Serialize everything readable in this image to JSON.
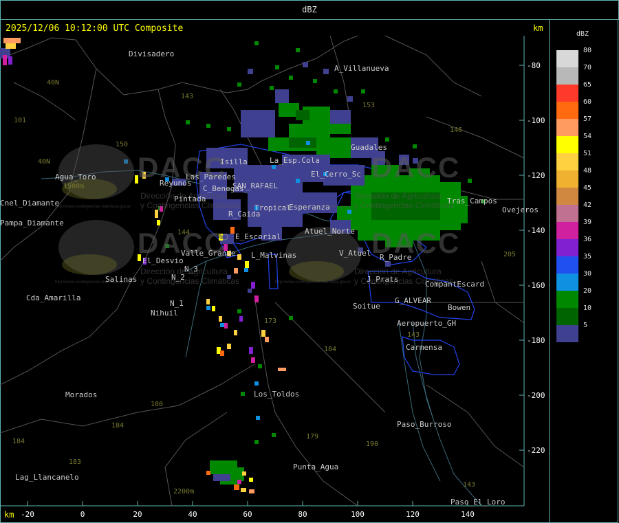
{
  "header": {
    "title": "dBZ"
  },
  "stamp": "2025/12/06 10:12:00 UTC Composite",
  "units": {
    "top": "km",
    "bottom": "km"
  },
  "y_ticks": [
    "-80",
    "-100",
    "-120",
    "-140",
    "-160",
    "-180",
    "-200",
    "-220"
  ],
  "x_ticks": [
    "-20",
    "0",
    "20",
    "40",
    "60",
    "80",
    "100",
    "120",
    "140"
  ],
  "legend": {
    "title": "dBZ",
    "items": [
      {
        "label": "80",
        "color": "#d8d8d8"
      },
      {
        "label": "70",
        "color": "#b8b8b8"
      },
      {
        "label": "65",
        "color": "#ff3a2a"
      },
      {
        "label": "60",
        "color": "#ff6a10"
      },
      {
        "label": "57",
        "color": "#ff9a60"
      },
      {
        "label": "54",
        "color": "#ffff00"
      },
      {
        "label": "51",
        "color": "#ffd040"
      },
      {
        "label": "48",
        "color": "#f0b030"
      },
      {
        "label": "45",
        "color": "#d08840"
      },
      {
        "label": "42",
        "color": "#c07090"
      },
      {
        "label": "39",
        "color": "#d020a0"
      },
      {
        "label": "36",
        "color": "#8020d0"
      },
      {
        "label": "35",
        "color": "#2050f0"
      },
      {
        "label": "30",
        "color": "#1090e0"
      },
      {
        "label": "20",
        "color": "#008800"
      },
      {
        "label": "10",
        "color": "#006400"
      },
      {
        "label": "5",
        "color": "#404090"
      }
    ]
  },
  "places": [
    "Divisadero",
    "A_Villanueva",
    "Guadales",
    "Isilla",
    "La_Esp.Cola",
    "El_Cerro_Sc",
    "C_Benegas",
    "SAN_RAFAEL",
    "Pintada",
    "R_Caida",
    "Atuel_Norte",
    "E_Escorial",
    "V_Atuel",
    "R_Padre",
    "L_Malvinas",
    "Valle_Grande",
    "El_Desvio",
    "Salinas",
    "N_3",
    "N_2",
    "N_1",
    "Nihuil",
    "J_Prats",
    "CompantEscard",
    "G_ALVEAR",
    "Bowen",
    "Soitue",
    "Aeropuerto_GH",
    "Carmensa",
    "Morados",
    "Los_Toldos",
    "Paso_Burroso",
    "Punta_Agua",
    "Lag_Llancanelo",
    "Paso_El_Loro",
    "Agua_Toro",
    "Pampa_Diamante",
    "Cda_Amarilla",
    "Ovejeros",
    "Tras_Campos",
    "Reyunos",
    "Las_Paredes",
    "Cnel_Diamante",
    "Esperanza",
    "Tropical"
  ],
  "routes": [
    "40N",
    "143",
    "153",
    "146",
    "101",
    "150",
    "40N",
    "144",
    "173",
    "184",
    "180",
    "184",
    "179",
    "190",
    "143",
    "205",
    "183",
    "184",
    "143",
    "1500m",
    "2200m"
  ],
  "watermark": {
    "brand": "DACC",
    "subtitle_1": "Dirección de Agricultura",
    "subtitle_2": "y Contingencias Climáticas",
    "url": "http://www.contingencias.mendoza.gov.ar"
  }
}
